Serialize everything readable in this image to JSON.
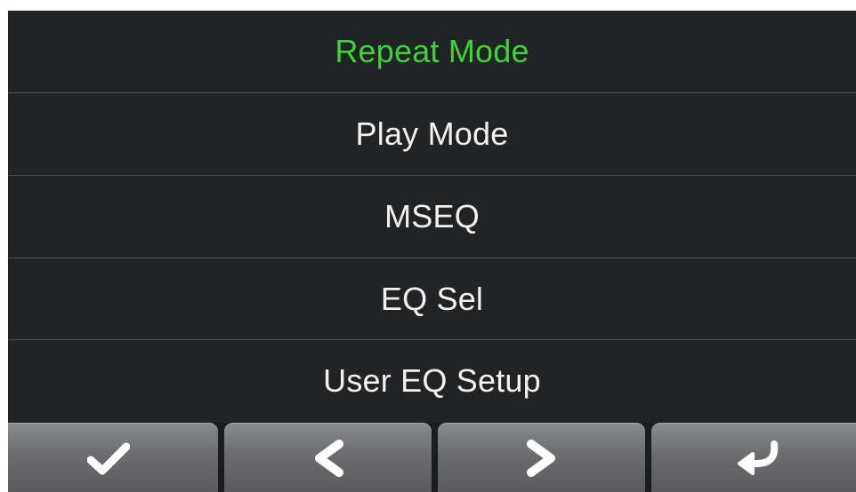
{
  "menu": {
    "items": [
      {
        "label": "Repeat Mode",
        "selected": true
      },
      {
        "label": "Play Mode",
        "selected": false
      },
      {
        "label": "MSEQ",
        "selected": false
      },
      {
        "label": "EQ Sel",
        "selected": false
      },
      {
        "label": "User EQ Setup",
        "selected": false
      }
    ]
  },
  "toolbar": {
    "buttons": [
      {
        "icon": "checkmark-icon"
      },
      {
        "icon": "chevron-left-icon"
      },
      {
        "icon": "chevron-right-icon"
      },
      {
        "icon": "return-arrow-icon"
      }
    ]
  },
  "colors": {
    "background": "#222325",
    "text": "#f2f2f2",
    "selected_text": "#3fd23a",
    "divider": "#4d4e51",
    "button_face": "#6b6c6e",
    "icon": "#ffffff"
  }
}
